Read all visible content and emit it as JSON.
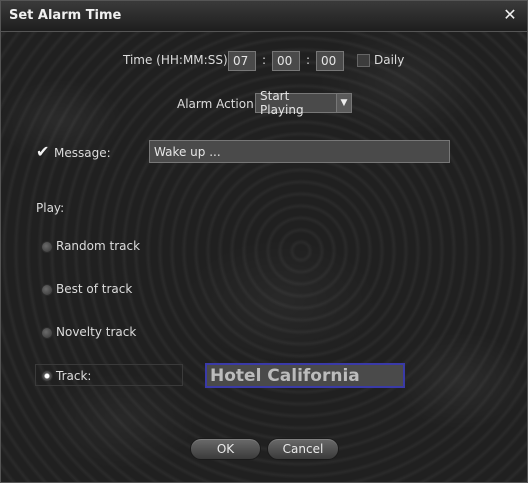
{
  "window": {
    "title": "Set Alarm Time",
    "close_glyph": "✕"
  },
  "time": {
    "label": "Time (HH:MM:SS)",
    "hours": "07",
    "minutes": "00",
    "seconds": "00",
    "separator": ":",
    "daily_label": "Daily",
    "daily_checked": false
  },
  "action": {
    "label": "Alarm Action",
    "selected": "Start Playing"
  },
  "message": {
    "checked": true,
    "label": "Message:",
    "value": "Wake up ..."
  },
  "play": {
    "label": "Play:",
    "options": [
      {
        "label": "Random track",
        "selected": false
      },
      {
        "label": "Best of track",
        "selected": false
      },
      {
        "label": "Novelty track",
        "selected": false
      },
      {
        "label": "Track:",
        "selected": true
      }
    ],
    "track_value": "Hotel California"
  },
  "buttons": {
    "ok": "OK",
    "cancel": "Cancel"
  }
}
